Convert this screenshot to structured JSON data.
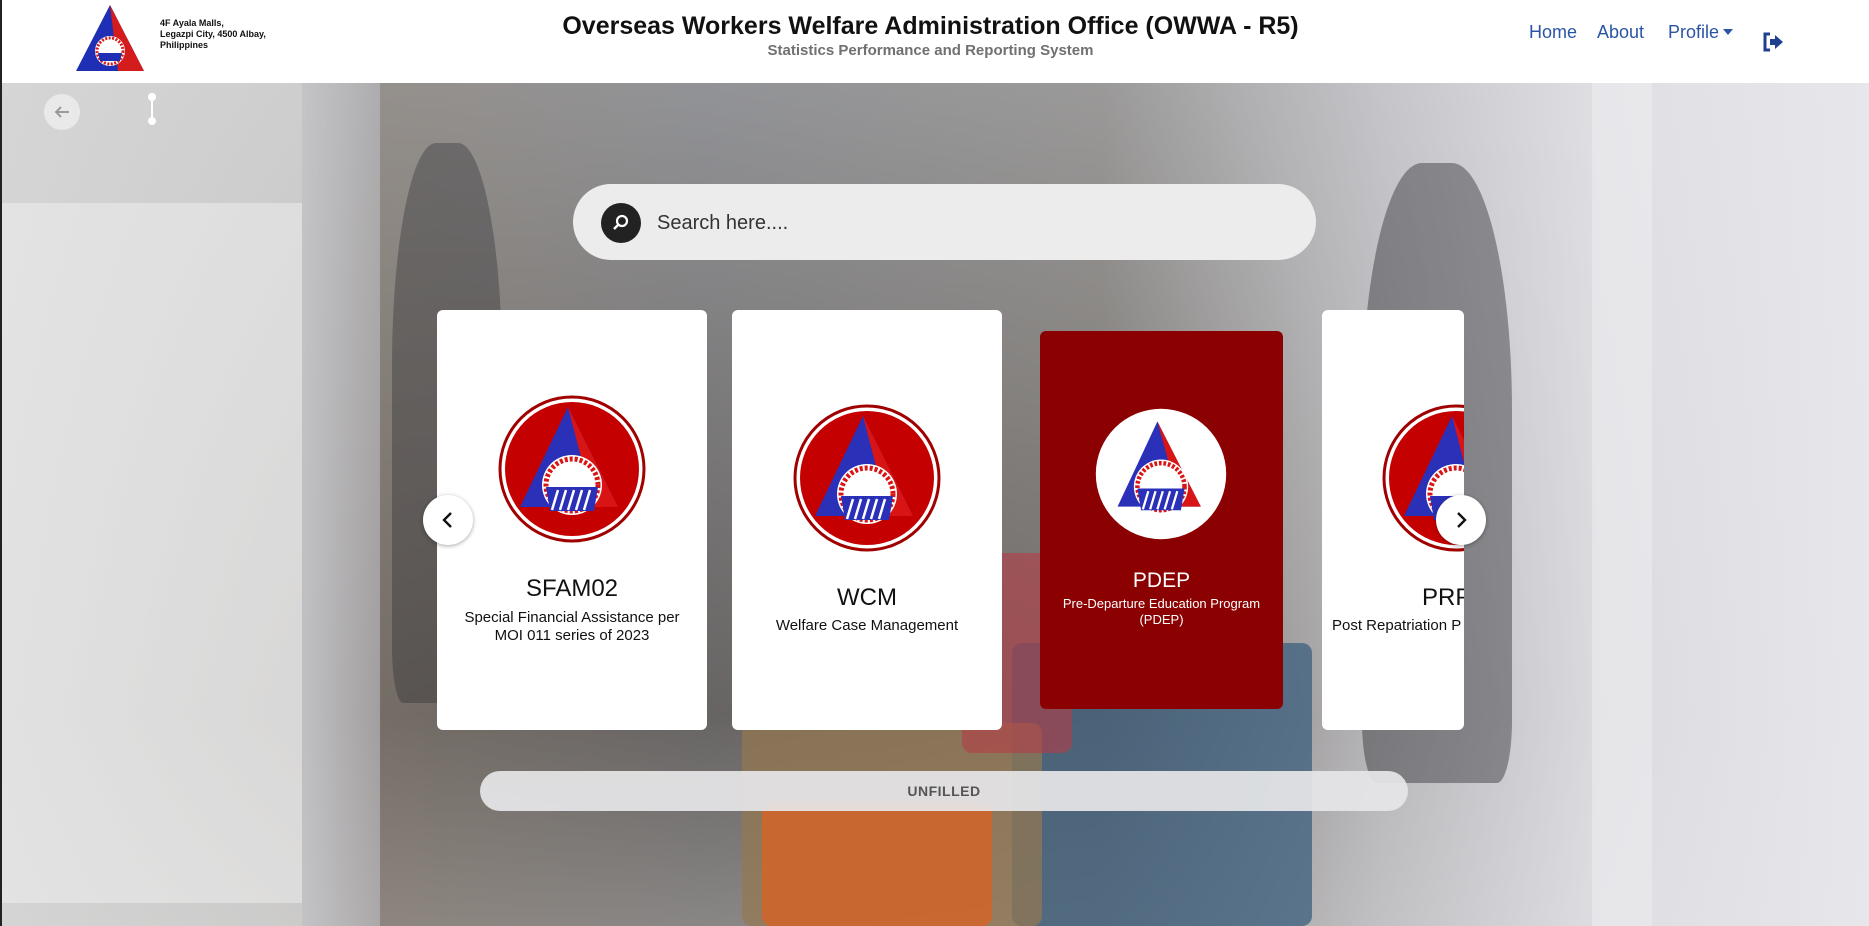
{
  "header": {
    "address_lines": [
      "4F Ayala Malls,",
      "Legazpi City, 4500 Albay,",
      "Philippines"
    ],
    "title": "Overseas Workers Welfare Administration Office (OWWA - R5)",
    "subtitle": "Statistics Performance and Reporting System",
    "logo_icon": "owwa-logo-icon",
    "nav": {
      "home": "Home",
      "about": "About",
      "profile": "Profile"
    },
    "logout_icon": "logout-icon"
  },
  "toolbar": {
    "back_icon": "arrow-left-icon",
    "timeline_icon": "timeline-icon"
  },
  "search": {
    "placeholder": "Search here....",
    "value": ""
  },
  "cards": [
    {
      "code": "SFAM02",
      "description": "Special Financial Assistance per MOI 011 series of 2023",
      "selected": false
    },
    {
      "code": "WCM",
      "description": "Welfare Case Management",
      "selected": false
    },
    {
      "code": "PDEP",
      "description": "Pre-Departure Education Program (PDEP)",
      "selected": true
    },
    {
      "code": "PRP",
      "description": "Post Repatriation P",
      "selected": false
    }
  ],
  "carousel": {
    "prev_icon": "chevron-left-icon",
    "next_icon": "chevron-right-icon"
  },
  "status": {
    "label": "UNFILLED"
  },
  "colors": {
    "nav_link": "#2a55a5",
    "selected_card": "#8b0000",
    "logo_red": "#d41c1c",
    "logo_blue": "#1f2fb5"
  }
}
